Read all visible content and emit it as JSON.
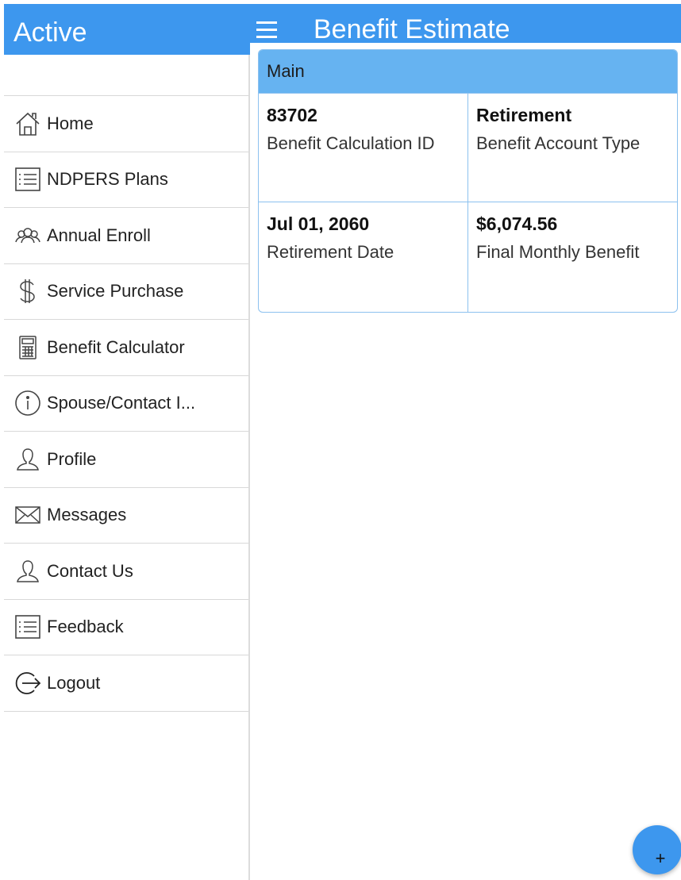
{
  "header": {
    "left_title": "Active",
    "right_title": "Benefit Estimate"
  },
  "sidebar": {
    "items": [
      {
        "label": "Home",
        "icon": "home-icon"
      },
      {
        "label": "NDPERS Plans",
        "icon": "list-icon"
      },
      {
        "label": "Annual Enroll",
        "icon": "people-icon"
      },
      {
        "label": "Service Purchase",
        "icon": "dollar-icon"
      },
      {
        "label": "Benefit Calculator",
        "icon": "calculator-icon"
      },
      {
        "label": "Spouse/Contact I...",
        "icon": "info-icon"
      },
      {
        "label": "Profile",
        "icon": "person-icon"
      },
      {
        "label": "Messages",
        "icon": "mail-icon"
      },
      {
        "label": "Contact Us",
        "icon": "person-icon"
      },
      {
        "label": "Feedback",
        "icon": "list-icon"
      },
      {
        "label": "Logout",
        "icon": "logout-icon"
      }
    ]
  },
  "card": {
    "header": "Main",
    "rows": [
      [
        {
          "value": "83702",
          "caption": "Benefit Calculation ID"
        },
        {
          "value": "Retirement",
          "caption": "Benefit Account Type"
        }
      ],
      [
        {
          "value": "Jul 01, 2060",
          "caption": "Retirement Date"
        },
        {
          "value": "$6,074.56",
          "caption": "Final Monthly Benefit"
        }
      ]
    ]
  },
  "fab": {
    "label": "+"
  },
  "colors": {
    "accent": "#3d97ee",
    "card_header": "#66b3f1",
    "card_border": "#8cc1ef"
  }
}
